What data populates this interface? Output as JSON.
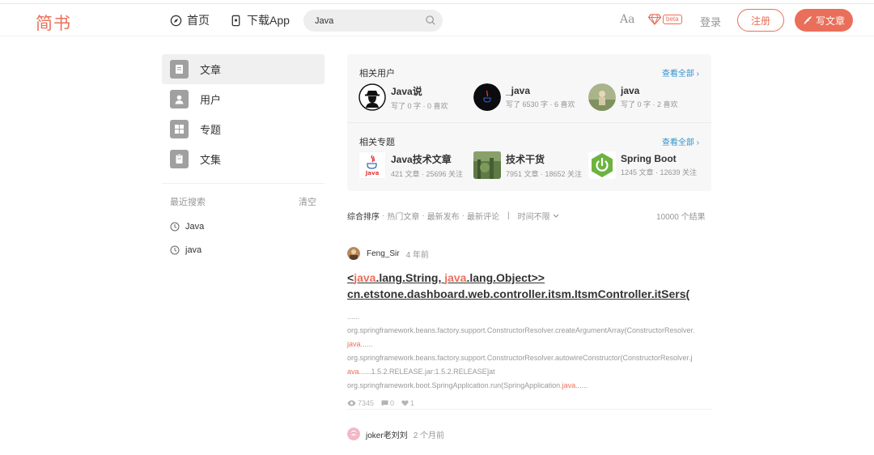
{
  "header": {
    "logo": "简书",
    "nav_home": "首页",
    "nav_app": "下载App",
    "search_value": "Java",
    "aa": "Aa",
    "beta": "beta",
    "login": "登录",
    "register": "注册",
    "write": "写文章"
  },
  "sidebar": {
    "items": [
      {
        "label": "文章",
        "active": true
      },
      {
        "label": "用户",
        "active": false
      },
      {
        "label": "专题",
        "active": false
      },
      {
        "label": "文集",
        "active": false
      }
    ],
    "recent_title": "最近搜索",
    "clear": "清空",
    "recent": [
      "Java",
      "java"
    ]
  },
  "related": {
    "users_title": "相关用户",
    "users_more": "查看全部 ›",
    "users": [
      {
        "name": "Java说",
        "meta": "写了 0 字 · 0 喜欢"
      },
      {
        "name": "_java",
        "meta": "写了 6530 字 · 6 喜欢"
      },
      {
        "name": "java",
        "meta": "写了 0 字 · 2 喜欢"
      }
    ],
    "topics_title": "相关专题",
    "topics_more": "查看全部 ›",
    "topics": [
      {
        "name": "Java技术文章",
        "meta": "421 文章 · 25696 关注"
      },
      {
        "name": "技术干货",
        "meta": "7951 文章 · 18652 关注"
      },
      {
        "name": "Spring Boot",
        "meta": "1245 文章 · 12639 关注"
      }
    ]
  },
  "sort": {
    "options": [
      "综合排序",
      "热门文章",
      "最新发布",
      "最新评论"
    ],
    "time": "时间不限",
    "count": "10000 个结果"
  },
  "article": {
    "author": "Feng_Sir",
    "time": "4 年前",
    "title_1": "<",
    "title_hl1": "java",
    "title_2": ".lang.String, ",
    "title_hl2": "java",
    "title_3": ".lang.Object>>",
    "title_line2": "cn.etstone.dashboard.web.controller.itsm.ItsmController.itSers(",
    "body_dots": "......",
    "body_line1": "org.springframework.beans.factory.support.ConstructorResolver.createArgumentArray(ConstructorResolver.",
    "body_line2_hl": "java",
    "body_line2": "......",
    "body_line3": "org.springframework.beans.factory.support.ConstructorResolver.autowireConstructor(ConstructorResolver.",
    "body_line3_hl": "j",
    "body_line4_hl": "ava",
    "body_line4": "......1.5.2.RELEASE.jar:1.5.2.RELEASE]at",
    "body_line5": "org.springframework.boot.SpringApplication.run(SpringApplication.",
    "body_line5_hl": "java",
    "body_line5_end": "......",
    "views": "7345",
    "comments": "0",
    "likes": "1"
  },
  "article2": {
    "author": "joker老刘刘",
    "time": "2 个月前"
  },
  "colors": {
    "accent": "#ea6f5a",
    "link": "#3194d0"
  }
}
